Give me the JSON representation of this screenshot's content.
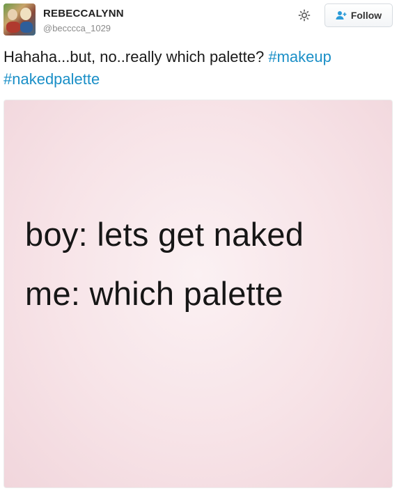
{
  "tweet": {
    "display_name": "REBECCALYNN",
    "handle": "@becccca_1029",
    "follow_label": "Follow",
    "text_plain": "Hahaha...but, no..really which palette? ",
    "hashtags": [
      "#makeup",
      "#nakedpalette"
    ],
    "icons": {
      "settings": "gear-icon",
      "follow": "add-person-icon"
    },
    "colors": {
      "hashtag": "#1a8fc7",
      "follow_icon": "#2b9bd8"
    }
  },
  "media": {
    "line1": "boy: lets get naked",
    "line2": "me: which palette",
    "background": "#f7e3e7"
  }
}
